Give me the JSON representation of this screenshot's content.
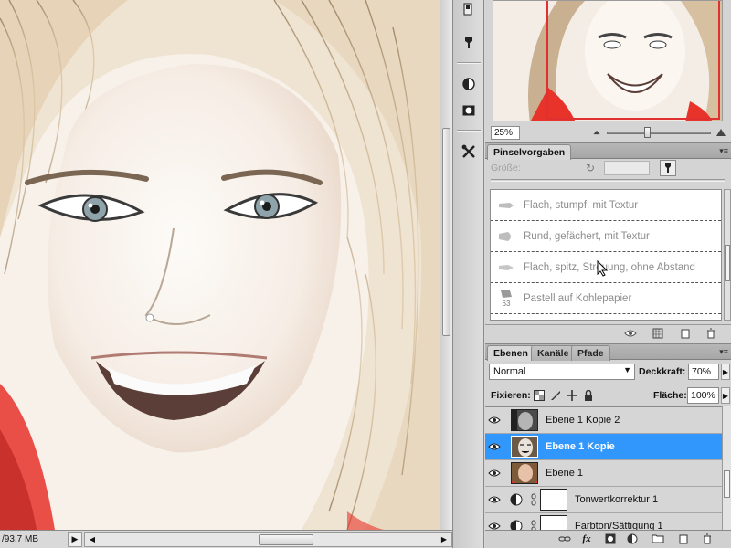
{
  "status": {
    "doc_size": "/93,7 MB"
  },
  "navigator": {
    "zoom": "25%"
  },
  "brushes": {
    "tab_label": "Pinselvorgaben",
    "size_label": "Größe:",
    "items": [
      {
        "name": "Flach, stumpf, mit Textur",
        "icon": "flat-blunt-brush-icon"
      },
      {
        "name": "Rund, gefächert, mit Textur",
        "icon": "round-fan-brush-icon"
      },
      {
        "name": "Flach, spitz, Streuung, ohne Abstand",
        "icon": "flat-pointed-brush-icon"
      },
      {
        "name": "Pastell auf Kohlepapier",
        "icon": "pastel-brush-icon",
        "size": "63"
      }
    ]
  },
  "layers_panel": {
    "tabs": [
      {
        "label": "Ebenen",
        "active": true
      },
      {
        "label": "Kanäle",
        "active": false
      },
      {
        "label": "Pfade",
        "active": false
      }
    ],
    "blend_mode": "Normal",
    "opacity_label": "Deckkraft:",
    "opacity": "70%",
    "lock_label": "Fixieren:",
    "fill_label": "Fläche:",
    "fill": "100%",
    "layers": [
      {
        "name": "Ebene 1 Kopie 2",
        "type": "image-bw",
        "selected": false
      },
      {
        "name": "Ebene 1 Kopie",
        "type": "image-face",
        "selected": true
      },
      {
        "name": "Ebene 1",
        "type": "image-color",
        "selected": false
      },
      {
        "name": "Tonwertkorrektur 1",
        "type": "adjustment",
        "selected": false
      },
      {
        "name": "Farbton/Sättigung 1",
        "type": "adjustment",
        "selected": false
      }
    ]
  },
  "colors": {
    "selection": "#3297fd",
    "nav_frame": "#e03030",
    "accent_red": "#e8332a"
  }
}
